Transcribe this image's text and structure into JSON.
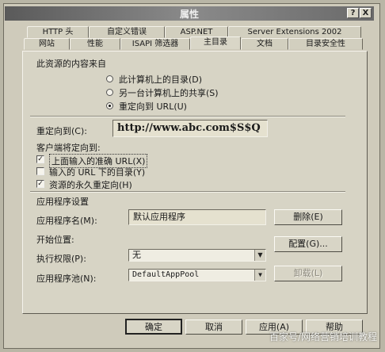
{
  "window": {
    "title": "属性",
    "help_btn": "?",
    "close_btn": "X"
  },
  "tabs": {
    "row1": [
      "HTTP 头",
      "自定义错误",
      "ASP.NET",
      "Server Extensions 2002"
    ],
    "row2": [
      "网站",
      "性能",
      "ISAPI 筛选器",
      "主目录",
      "文档",
      "目录安全性"
    ],
    "active": "主目录"
  },
  "content_source": {
    "label": "此资源的内容来自",
    "options": [
      "此计算机上的目录(D)",
      "另一台计算机上的共享(S)",
      "重定向到 URL(U)"
    ],
    "selected_index": 2
  },
  "redirect": {
    "label": "重定向到(C):",
    "value": "http://www.abc.com$S$Q"
  },
  "client_redirect": {
    "label": "客户端将定向到:",
    "options": [
      {
        "label": "上面输入的准确 URL(X)",
        "checked": true
      },
      {
        "label": "输入的 URL 下的目录(Y)",
        "checked": false
      },
      {
        "label": "资源的永久重定向(H)",
        "checked": true
      }
    ]
  },
  "app_settings": {
    "section_label": "应用程序设置",
    "app_name_label": "应用程序名(M):",
    "app_name_value": "默认应用程序",
    "start_pos_label": "开始位置:",
    "exec_perm_label": "执行权限(P):",
    "exec_perm_value": "无",
    "app_pool_label": "应用程序池(N):",
    "app_pool_value": "DefaultAppPool",
    "remove_btn": "删除(E)",
    "config_btn": "配置(G)...",
    "unload_btn": "卸载(L)"
  },
  "footer": {
    "ok": "确定",
    "cancel": "取消",
    "apply": "应用(A)",
    "help": "帮助"
  },
  "watermark": "百家号/网络营销培训教程"
}
